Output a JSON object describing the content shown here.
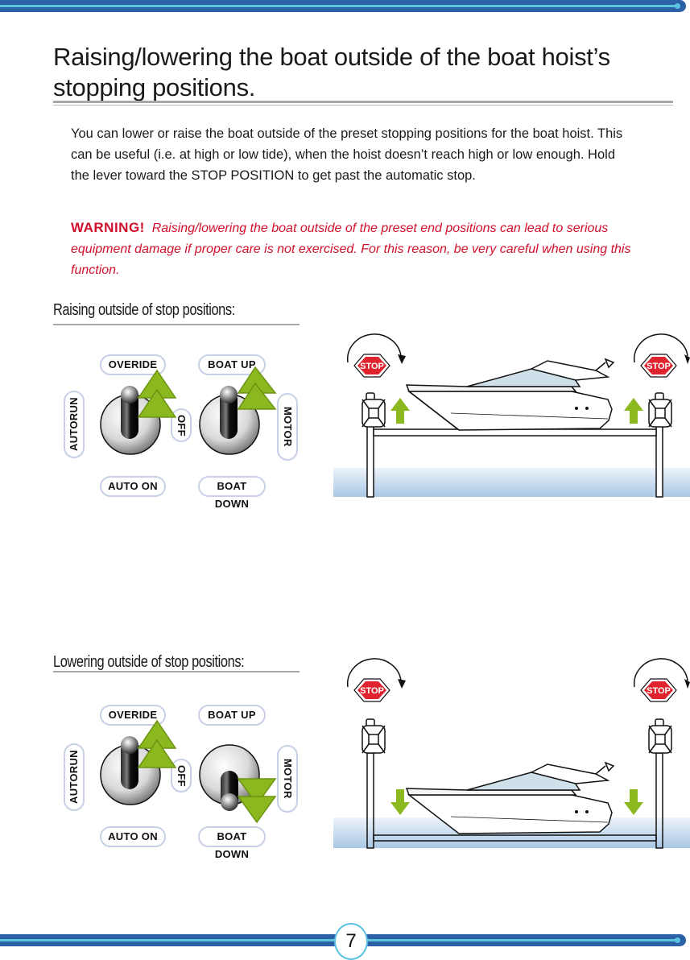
{
  "header": {
    "decoration": "top-rule"
  },
  "page": {
    "title": "Raising/lowering the boat outside of the boat hoist’s stopping positions.",
    "intro": "You can lower or raise the boat outside of the preset stopping positions for the boat hoist.  This can be useful (i.e. at high or low tide), when the hoist doesn’t reach high or low enough.  Hold the lever toward the STOP POSITION to get past the automatic stop.",
    "warning_label": "WARNING!",
    "warning_text": "Raising/lowering the boat outside of the preset end positions can lead to serious equipment damage if proper care is not exercised.  For this reason, be very careful when using this function.",
    "page_number": "7"
  },
  "colors": {
    "brand_blue": "#2c61a8",
    "accent_cyan": "#5bc2e0",
    "warning_red": "#d0112b",
    "arrow_green": "#8ab81e",
    "stop_red": "#e0242f",
    "water_blue": "#a9c8e4"
  },
  "sections": [
    {
      "title": "Raising outside of stop positions:",
      "switch_labels": {
        "top_left": "OVERIDE",
        "top_right": "BOAT UP",
        "left": "AUTORUN",
        "middle": "OFF",
        "right": "MOTOR",
        "bottom_left": "AUTO ON",
        "bottom_right": "BOAT DOWN"
      },
      "left_switch_position": "up",
      "right_switch_position": "up",
      "left_arrow": "double-up-arrow-icon",
      "right_arrow": "double-up-arrow-icon",
      "scene": {
        "stop_sign": "STOP",
        "motion": "up",
        "boat_position": "raised"
      }
    },
    {
      "title": "Lowering outside of stop positions:",
      "switch_labels": {
        "top_left": "OVERIDE",
        "top_right": "BOAT UP",
        "left": "AUTORUN",
        "middle": "OFF",
        "right": "MOTOR",
        "bottom_left": "AUTO ON",
        "bottom_right": "BOAT DOWN"
      },
      "left_switch_position": "up",
      "right_switch_position": "down",
      "left_arrow": "double-up-arrow-icon",
      "right_arrow": "double-down-arrow-icon",
      "scene": {
        "stop_sign": "STOP",
        "motion": "down",
        "boat_position": "lowered"
      }
    }
  ]
}
